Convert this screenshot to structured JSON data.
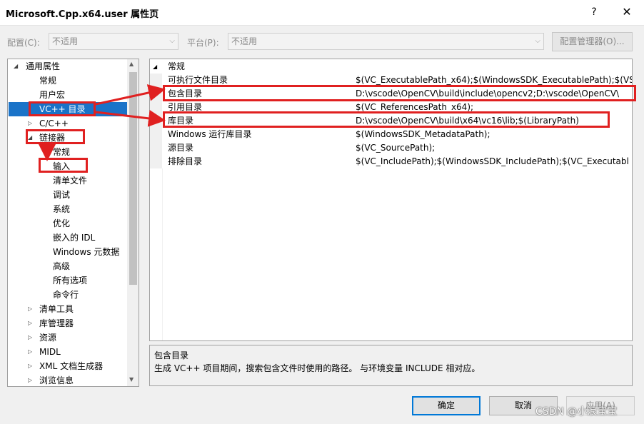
{
  "window": {
    "title": "Microsoft.Cpp.x64.user 属性页",
    "help": "?",
    "close": "✕"
  },
  "config_row": {
    "config_label": "配置(C):",
    "config_value": "不适用",
    "platform_label": "平台(P):",
    "platform_value": "不适用",
    "config_manager_button": "配置管理器(O)..."
  },
  "tree": {
    "items": [
      {
        "label": "通用属性",
        "arrow": "◢"
      },
      {
        "label": "常规"
      },
      {
        "label": "用户宏"
      },
      {
        "label": "VC++ 目录"
      },
      {
        "label": "C/C++",
        "arrow": "▷"
      },
      {
        "label": "链接器",
        "arrow": "◢"
      },
      {
        "label": "常规"
      },
      {
        "label": "输入"
      },
      {
        "label": "清单文件"
      },
      {
        "label": "调试"
      },
      {
        "label": "系统"
      },
      {
        "label": "优化"
      },
      {
        "label": "嵌入的 IDL"
      },
      {
        "label": "Windows 元数据"
      },
      {
        "label": "高级"
      },
      {
        "label": "所有选项"
      },
      {
        "label": "命令行"
      },
      {
        "label": "清单工具",
        "arrow": "▷"
      },
      {
        "label": "库管理器",
        "arrow": "▷"
      },
      {
        "label": "资源",
        "arrow": "▷"
      },
      {
        "label": "MIDL",
        "arrow": "▷"
      },
      {
        "label": "XML 文档生成器",
        "arrow": "▷"
      },
      {
        "label": "浏览信息",
        "arrow": "▷"
      }
    ]
  },
  "grid": {
    "category": "常规",
    "category_arrow": "◢",
    "rows": [
      {
        "name": "可执行文件目录",
        "value": "$(VC_ExecutablePath_x64);$(WindowsSDK_ExecutablePath);$(VS"
      },
      {
        "name": "包含目录",
        "value": "D:\\vscode\\OpenCV\\build\\include\\opencv2;D:\\vscode\\OpenCV\\"
      },
      {
        "name": "引用目录",
        "value": "$(VC_ReferencesPath_x64);"
      },
      {
        "name": "库目录",
        "value": "D:\\vscode\\OpenCV\\build\\x64\\vc16\\lib;$(LibraryPath)"
      },
      {
        "name": "Windows 运行库目录",
        "value": "$(WindowsSDK_MetadataPath);"
      },
      {
        "name": "源目录",
        "value": "$(VC_SourcePath);"
      },
      {
        "name": "排除目录",
        "value": "$(VC_IncludePath);$(WindowsSDK_IncludePath);$(VC_Executabl"
      }
    ]
  },
  "description": {
    "title": "包含目录",
    "text": "生成 VC++ 项目期间，搜索包含文件时使用的路径。  与环境变量 INCLUDE 相对应。"
  },
  "buttons": {
    "ok": "确定",
    "cancel": "取消",
    "apply": "应用(A)"
  },
  "watermark": "CSDN @小浪宝宝",
  "colors": {
    "selection": "#1a73c8",
    "annotation_red": "#e02020",
    "focus_border": "#0078d7"
  }
}
